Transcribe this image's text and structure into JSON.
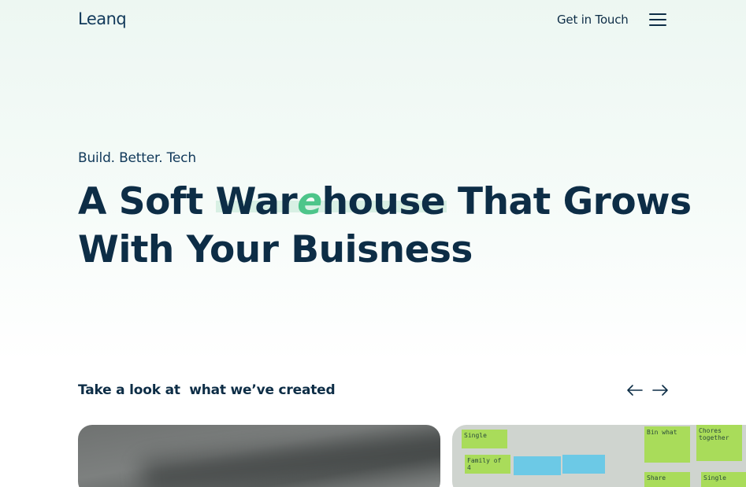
{
  "header": {
    "logo": "Leanq",
    "cta_label": "Get in Touch"
  },
  "hero": {
    "eyebrow": "Build. Better. Tech",
    "headline_part1": "A Soft ",
    "headline_highlight_pre": "War",
    "headline_highlight_e": "e",
    "headline_highlight_post": "house",
    "headline_part2": " That Grows",
    "headline_line2": "With Your Buisness"
  },
  "showcase": {
    "title": "Take a look at  what we’ve created"
  },
  "sticky_notes": [
    {
      "text": "Single"
    },
    {
      "text": "Family of 4"
    },
    {
      "text": "Bin\nwhat"
    },
    {
      "text": "Chores\ntogether"
    },
    {
      "text": "Share"
    },
    {
      "text": "Single"
    }
  ],
  "colors": {
    "primary_text": "#0d2d46",
    "accent_green": "#4dc58a",
    "highlight_bg": "#d8f0e4",
    "background_top": "#edf7f2"
  },
  "icons": {
    "menu": "hamburger-icon",
    "prev": "arrow-left-icon",
    "next": "arrow-right-icon"
  }
}
